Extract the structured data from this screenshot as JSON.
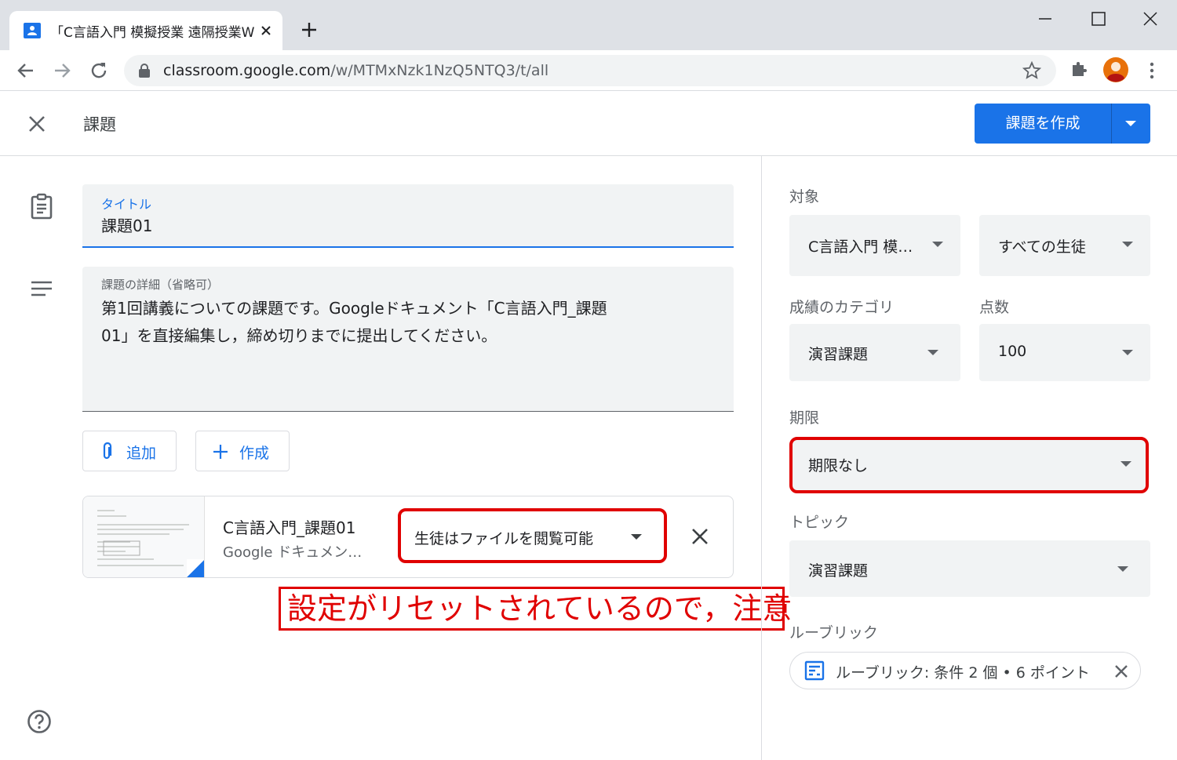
{
  "browser": {
    "tab_title": "「C言語入門 模擬授業 遠隔授業W",
    "url_host": "classroom.google.com",
    "url_path": "/w/MTMxNzk1NzQ5NTQ3/t/all"
  },
  "header": {
    "title": "課題",
    "create_label": "課題を作成"
  },
  "form": {
    "title_label": "タイトル",
    "title_value": "課題01",
    "details_label": "課題の詳細（省略可）",
    "details_line1": "第1回講義についての課題です。Googleドキュメント「C言語入門_課題",
    "details_line2": "01」を直接編集し，締め切りまでに提出してください。",
    "add_label": "追加",
    "create_label": "作成"
  },
  "attachment": {
    "name": "C言語入門_課題01",
    "type": "Google ドキュメン…",
    "permission": "生徒はファイルを閲覧可能"
  },
  "notice": "設定がリセットされているので，注意",
  "side": {
    "target_label": "対象",
    "class_value": "C言語入門 模…",
    "students_value": "すべての生徒",
    "category_label": "成績のカテゴリ",
    "category_value": "演習課題",
    "points_label": "点数",
    "points_value": "100",
    "due_label": "期限",
    "due_value": "期限なし",
    "topic_label": "トピック",
    "topic_value": "演習課題",
    "rubric_label": "ルーブリック",
    "rubric_chip": "ルーブリック: 条件 2 個 • 6 ポイント"
  },
  "colors": {
    "accent": "#1a73e8",
    "highlight": "#e00000"
  }
}
